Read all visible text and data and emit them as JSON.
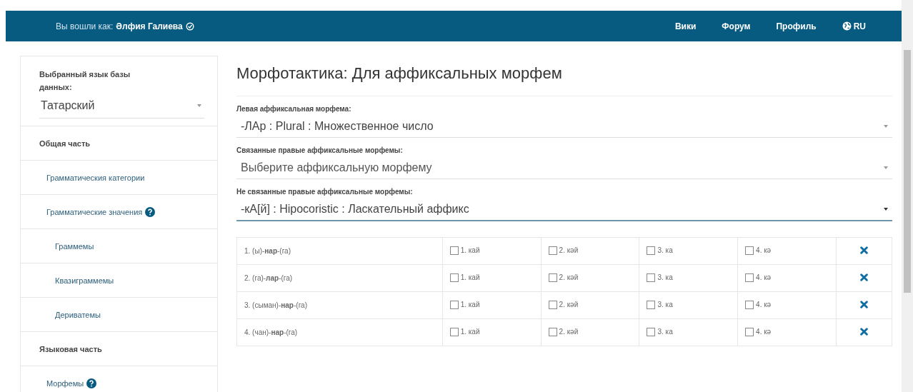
{
  "top_bar": {
    "logged_in_label": "Вы вошли как:",
    "user_name": "Әлфия Галиева",
    "nav": [
      "Вики",
      "Форум",
      "Профиль"
    ],
    "language": "RU"
  },
  "sidebar": {
    "db_language_label": "Выбранный язык базы данных:",
    "db_language": "Татарский",
    "items": [
      {
        "label": "Общая часть",
        "kind": "section",
        "help": false
      },
      {
        "label": "Грамматическия категории",
        "kind": "link",
        "help": false
      },
      {
        "label": "Грамматические значения",
        "kind": "link",
        "help": true
      },
      {
        "label": "Граммемы",
        "kind": "sublink",
        "help": false
      },
      {
        "label": "Квазиграммемы",
        "kind": "sublink",
        "help": false
      },
      {
        "label": "Дериватемы",
        "kind": "sublink",
        "help": false
      },
      {
        "label": "Языковая часть",
        "kind": "section",
        "help": false
      },
      {
        "label": "Морфемы",
        "kind": "link",
        "help": true
      }
    ]
  },
  "main": {
    "title": "Морфотактика: Для аффиксальных морфем",
    "fields": [
      {
        "label": "Левая аффиксальная морфема:",
        "value": "-ЛАр : Plural : Множественное число",
        "focused": false
      },
      {
        "label": "Связанные правые аффиксальные морфемы:",
        "placeholder": "Выберите аффиксальную морфему",
        "focused": false
      },
      {
        "label": "Не связанные правые аффиксальные морфемы:",
        "value": "-кА[й] : Hipocoristic : Ласкательный аффикс",
        "focused": true
      }
    ],
    "rows": [
      {
        "form": "1. (ы)-**нар**-(га)",
        "options": [
          {
            "label": "1. кай",
            "checked": false
          },
          {
            "label": "2. кәй",
            "checked": false
          },
          {
            "label": "3. ка",
            "checked": false
          },
          {
            "label": "4. кә",
            "checked": false
          }
        ]
      },
      {
        "form": "2. (га)-**лар**-(га)",
        "options": [
          {
            "label": "1. кай",
            "checked": false
          },
          {
            "label": "2. кәй",
            "checked": false
          },
          {
            "label": "3. ка",
            "checked": false
          },
          {
            "label": "4. кә",
            "checked": false
          }
        ]
      },
      {
        "form": "3. (сыман)-**нар**-(га)",
        "options": [
          {
            "label": "1. кай",
            "checked": false
          },
          {
            "label": "2. кәй",
            "checked": false
          },
          {
            "label": "3. ка",
            "checked": false
          },
          {
            "label": "4. кә",
            "checked": false
          }
        ]
      },
      {
        "form": "4. (чан)-**нар**-(га)",
        "options": [
          {
            "label": "1. кай",
            "checked": false
          },
          {
            "label": "2. кәй",
            "checked": false
          },
          {
            "label": "3. ка",
            "checked": false
          },
          {
            "label": "4. кә",
            "checked": false
          }
        ]
      }
    ]
  }
}
